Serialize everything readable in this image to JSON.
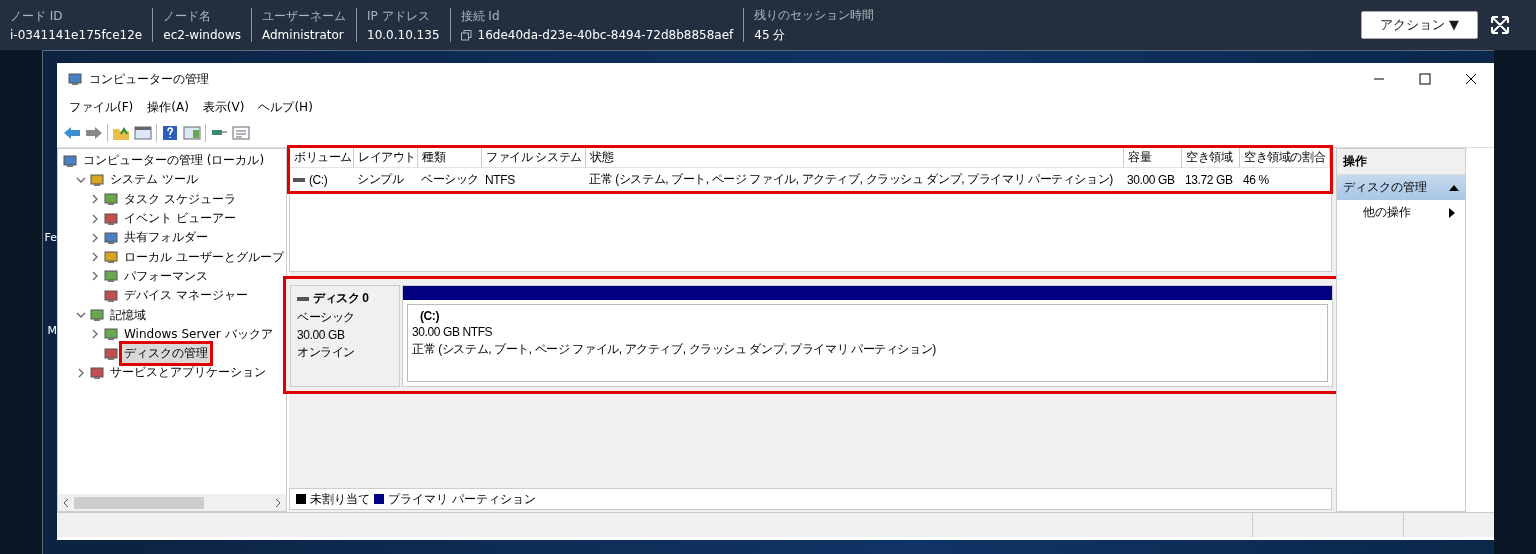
{
  "session_bar": {
    "fields": [
      {
        "label": "ノード ID",
        "value": "i-0341141e175fce12e",
        "copyable": false
      },
      {
        "label": "ノード名",
        "value": "ec2-windows",
        "copyable": false
      },
      {
        "label": "ユーザーネーム",
        "value": "Administrator",
        "copyable": false
      },
      {
        "label": "IP アドレス",
        "value": "10.0.10.135",
        "copyable": false
      },
      {
        "label": "接続 Id",
        "value": "16de40da-d23e-40bc-8494-72d8b8858aef",
        "copyable": true
      },
      {
        "label": "残りのセッション時間",
        "value": "45 分",
        "copyable": false
      }
    ],
    "action_button": "アクション ▼"
  },
  "desktop_icons": [
    {
      "label": "Fe"
    },
    {
      "label": "M"
    }
  ],
  "window": {
    "title": "コンピューターの管理",
    "menu": [
      "ファイル(F)",
      "操作(A)",
      "表示(V)",
      "ヘルプ(H)"
    ],
    "tree": [
      {
        "label": "コンピューターの管理 (ローカル)",
        "selected": false,
        "children": [
          {
            "label": "システム ツール",
            "expanded": true,
            "selected": false,
            "children": [
              {
                "label": "タスク スケジューラ",
                "expanded": false,
                "selected": false
              },
              {
                "label": "イベント ビューアー",
                "expanded": false,
                "selected": false
              },
              {
                "label": "共有フォルダー",
                "expanded": false,
                "selected": false
              },
              {
                "label": "ローカル ユーザーとグループ",
                "expanded": false,
                "selected": false
              },
              {
                "label": "パフォーマンス",
                "expanded": false,
                "selected": false
              },
              {
                "label": "デバイス マネージャー",
                "selected": false
              }
            ]
          },
          {
            "label": "記憶域",
            "expanded": true,
            "selected": false,
            "children": [
              {
                "label": "Windows Server バックア",
                "expanded": false,
                "selected": false
              },
              {
                "label": "ディスクの管理",
                "selected": true
              }
            ]
          },
          {
            "label": "サービスとアプリケーション",
            "expanded": false,
            "selected": false
          }
        ]
      }
    ],
    "volume_table": {
      "columns": [
        "ボリューム",
        "レイアウト",
        "種類",
        "ファイル システム",
        "状態",
        "容量",
        "空き領域",
        "空き領域の割合"
      ],
      "rows": [
        [
          "(C:)",
          "シンプル",
          "ベーシック",
          "NTFS",
          "正常 (システム, ブート, ページ ファイル, アクティブ, クラッシュ ダンプ, プライマリ パーティション)",
          "30.00 GB",
          "13.72 GB",
          "46 %"
        ]
      ]
    },
    "disk": {
      "name": "ディスク 0",
      "type": "ベーシック",
      "size": "30.00 GB",
      "status": "オンライン",
      "partitions": [
        {
          "label": "(C:)",
          "size_fs": "30.00 GB NTFS",
          "status": "正常 (システム, ブート, ページ ファイル, アクティブ, クラッシュ ダンプ, プライマリ パーティション)",
          "color": "#000080"
        }
      ]
    },
    "legend": [
      {
        "label": "未割り当て",
        "color": "#000000"
      },
      {
        "label": "プライマリ パーティション",
        "color": "#000080"
      }
    ],
    "actions": {
      "header": "操作",
      "section": "ディスクの管理",
      "items": [
        "他の操作"
      ]
    }
  }
}
